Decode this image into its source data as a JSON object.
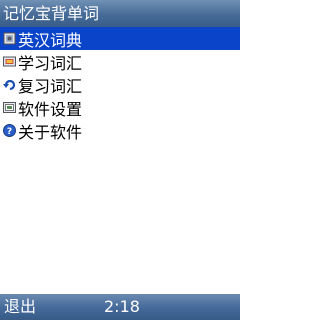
{
  "app": {
    "title": "记忆宝背单词"
  },
  "menu": {
    "items": [
      {
        "label": "英汉词典",
        "icon": "dictionary-icon",
        "selected": true
      },
      {
        "label": "学习词汇",
        "icon": "study-icon",
        "selected": false
      },
      {
        "label": "复习词汇",
        "icon": "review-icon",
        "selected": false
      },
      {
        "label": "软件设置",
        "icon": "settings-icon",
        "selected": false
      },
      {
        "label": "关于软件",
        "icon": "help-icon",
        "selected": false
      }
    ]
  },
  "softkeys": {
    "left": "退出"
  },
  "status": {
    "time": "2:18"
  },
  "colors": {
    "bar": "#466b97",
    "selection": "#0a44c8",
    "text": "#000000",
    "background": "#ffffff"
  }
}
